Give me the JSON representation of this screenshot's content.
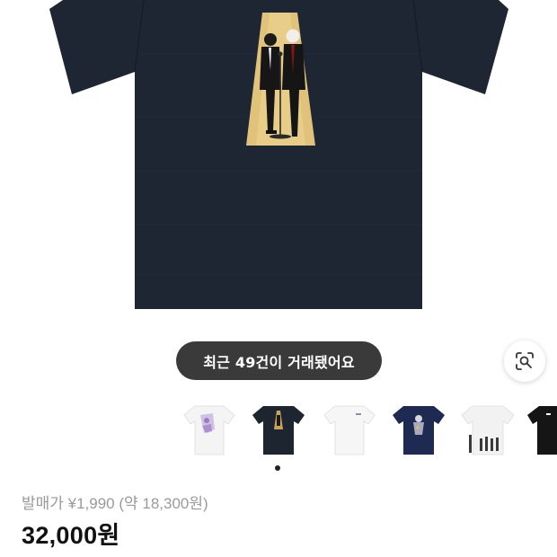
{
  "product": {
    "sales_badge": "최근 49건이 거래됐어요",
    "release_price": "발매가 ¥1,990 (약 18,300원)",
    "price": "32,000원"
  },
  "icons": {
    "lens": "lens-search-icon"
  },
  "thumbnails": [
    {
      "name": "thumb-white-purple-print",
      "shirt_color": "#f4f4f4",
      "print_color": "#9b7bc4"
    },
    {
      "name": "thumb-navy-gold-print",
      "shirt_color": "#1c2530",
      "print_color": "#c9a45a"
    },
    {
      "name": "thumb-white-small-logo",
      "shirt_color": "#f6f6f6",
      "print_color": "#8a8fa8"
    },
    {
      "name": "thumb-navy-figure-print",
      "shirt_color": "#1f2a52",
      "print_color": "#d7d7dc"
    },
    {
      "name": "thumb-white-group-print",
      "shirt_color": "#f2f2f2",
      "print_color": "#3a3a3a"
    },
    {
      "name": "thumb-black-partial",
      "shirt_color": "#151515",
      "print_color": "#ffffff"
    }
  ],
  "carousel": {
    "current_index": 1,
    "dot_count": 1
  },
  "colors": {
    "shirt": "#1d2632",
    "print_bg": "#e0c27a",
    "badge_bg": "#3a3a3a"
  }
}
